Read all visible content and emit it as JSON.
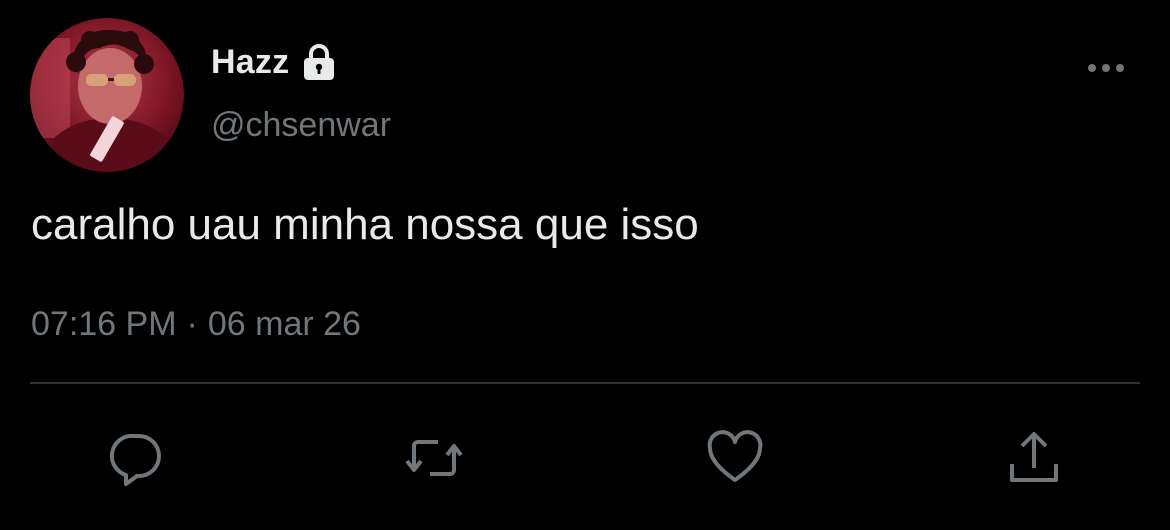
{
  "author": {
    "display_name": "Hazz",
    "handle": "@chsenwar",
    "protected": true
  },
  "tweet": {
    "text": "caralho uau minha nossa que isso",
    "time": "07:16 PM",
    "separator": "·",
    "date": "06 mar 26"
  },
  "icons": {
    "lock": "lock-icon",
    "more": "more-options-icon",
    "reply": "reply-icon",
    "retweet": "retweet-icon",
    "like": "heart-icon",
    "share": "share-icon"
  },
  "colors": {
    "background": "#000000",
    "primary_text": "#e7e9ea",
    "secondary_text": "#71767b",
    "divider": "#2f3336",
    "avatar_accent": "#b0203a"
  }
}
